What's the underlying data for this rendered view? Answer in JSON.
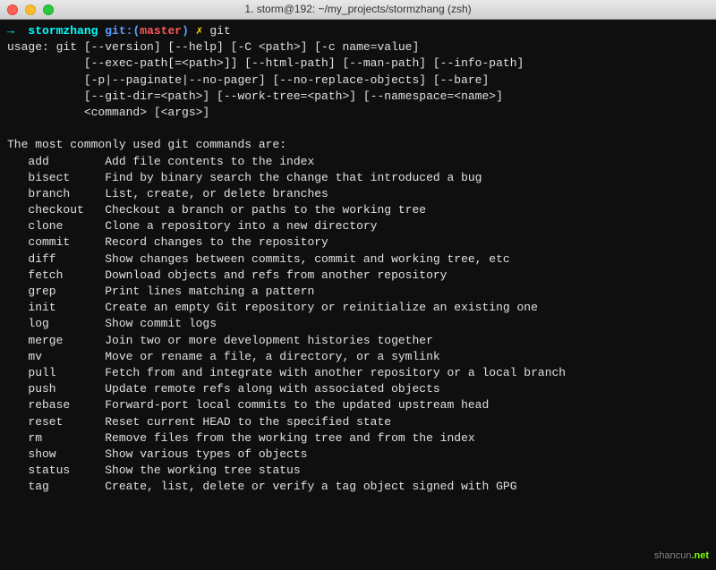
{
  "window": {
    "title": "1. storm@192: ~/my_projects/stormzhang (zsh)"
  },
  "prompt": {
    "arrow": "→",
    "user": "stormzhang",
    "git_label": "git:",
    "branch": "master",
    "separator": "✗",
    "command": "git"
  },
  "usage": [
    "usage: git [--version] [--help] [-C <path>] [-c name=value]",
    "           [--exec-path[=<path>]] [--html-path] [--man-path] [--info-path]",
    "           [-p|--paginate|--no-pager] [--no-replace-objects] [--bare]",
    "           [--git-dir=<path>] [--work-tree=<path>] [--namespace=<name>]",
    "           <command> [<args>]"
  ],
  "heading": "The most commonly used git commands are:",
  "commands": [
    {
      "name": "add",
      "desc": "Add file contents to the index"
    },
    {
      "name": "bisect",
      "desc": "Find by binary search the change that introduced a bug"
    },
    {
      "name": "branch",
      "desc": "List, create, or delete branches"
    },
    {
      "name": "checkout",
      "desc": "Checkout a branch or paths to the working tree"
    },
    {
      "name": "clone",
      "desc": "Clone a repository into a new directory"
    },
    {
      "name": "commit",
      "desc": "Record changes to the repository"
    },
    {
      "name": "diff",
      "desc": "Show changes between commits, commit and working tree, etc"
    },
    {
      "name": "fetch",
      "desc": "Download objects and refs from another repository"
    },
    {
      "name": "grep",
      "desc": "Print lines matching a pattern"
    },
    {
      "name": "init",
      "desc": "Create an empty Git repository or reinitialize an existing one"
    },
    {
      "name": "log",
      "desc": "Show commit logs"
    },
    {
      "name": "merge",
      "desc": "Join two or more development histories together"
    },
    {
      "name": "mv",
      "desc": "Move or rename a file, a directory, or a symlink"
    },
    {
      "name": "pull",
      "desc": "Fetch from and integrate with another repository or a local branch"
    },
    {
      "name": "push",
      "desc": "Update remote refs along with associated objects"
    },
    {
      "name": "rebase",
      "desc": "Forward-port local commits to the updated upstream head"
    },
    {
      "name": "reset",
      "desc": "Reset current HEAD to the specified state"
    },
    {
      "name": "rm",
      "desc": "Remove files from the working tree and from the index"
    },
    {
      "name": "show",
      "desc": "Show various types of objects"
    },
    {
      "name": "status",
      "desc": "Show the working tree status"
    },
    {
      "name": "tag",
      "desc": "Create, list, delete or verify a tag object signed with GPG"
    }
  ],
  "watermark": {
    "text1": "shancun",
    "text2": ".net"
  }
}
